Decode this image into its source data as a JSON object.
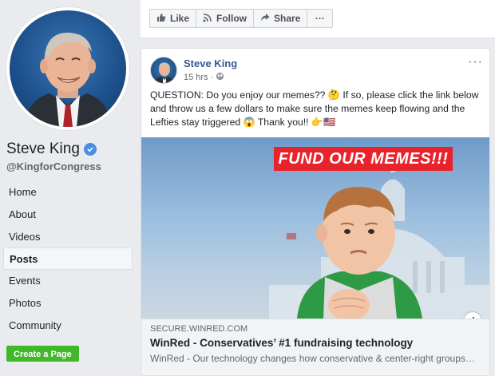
{
  "profile": {
    "name": "Steve King",
    "handle": "@KingforCongress"
  },
  "nav": {
    "items": [
      {
        "label": "Home"
      },
      {
        "label": "About"
      },
      {
        "label": "Videos"
      },
      {
        "label": "Posts"
      },
      {
        "label": "Events"
      },
      {
        "label": "Photos"
      },
      {
        "label": "Community"
      }
    ],
    "active": "Posts"
  },
  "create_page_label": "Create a Page",
  "actionbar": {
    "like_label": "Like",
    "follow_label": "Follow",
    "share_label": "Share",
    "more_label": "···"
  },
  "post": {
    "author": "Steve King",
    "time": "15 hrs ·",
    "more_label": "···",
    "text": "QUESTION: Do you enjoy our memes?? 🤔 If so, please click the link below and throw us a few dollars to make sure the memes keep flowing and the Lefties stay triggered 😱 Thank you!! 👉🇺🇸",
    "link": {
      "banner": "FUND OUR MEMES!!!",
      "domain": "SECURE.WINRED.COM",
      "title": "WinRed - Conservatives’ #1 fundraising technology",
      "description": "WinRed - Our technology changes how conservative & center-right groups…"
    }
  },
  "colors": {
    "accent_blue": "#385898",
    "create_green": "#42b72a",
    "banner_red": "#e8232b",
    "verified_blue": "#4a90e2"
  },
  "icons": [
    "verified-icon",
    "like-icon",
    "follow-icon",
    "share-icon",
    "globe-icon",
    "info-icon",
    "more-icon"
  ]
}
